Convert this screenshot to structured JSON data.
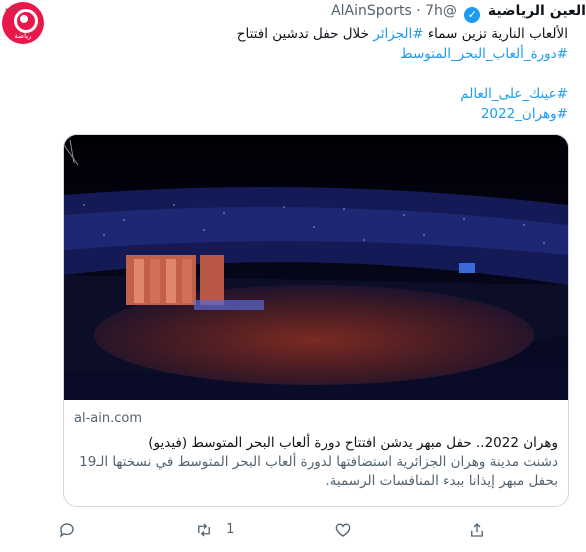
{
  "author": {
    "name": "العين الرياضية",
    "handle": "@AlAinSports",
    "separator": "·",
    "time": "7h",
    "avatar_label": "رياضة",
    "more_label": "···"
  },
  "tweet": {
    "line1_start": "الألعاب النارية تزين سماء ",
    "line1_hashtag": "#الجزائر",
    "line1_end": " خلال حفل تدشين افتتاح",
    "hashtag2": "#دورة_ألعاب_البحر_المتوسط",
    "hashtag3": "#عينك_على_العالم",
    "hashtag4": "#وهران_2022"
  },
  "card": {
    "domain": "al-ain.com",
    "title": "وهران 2022.. حفل مبهر يدشن افتتاح دورة ألعاب البحر المتوسط (فيديو)",
    "description": "دشنت مدينة وهران الجزائرية استضافتها لدورة ألعاب البحر المتوسط في نسختها الـ19 بحفل مبهر إيذانا ببدء المنافسات الرسمية."
  },
  "actions": {
    "reply_count": "",
    "retweet_count": "1",
    "like_count": ""
  },
  "colors": {
    "accent": "#1d9bf0",
    "avatar_bg": "#e8194a",
    "muted": "#536471"
  }
}
